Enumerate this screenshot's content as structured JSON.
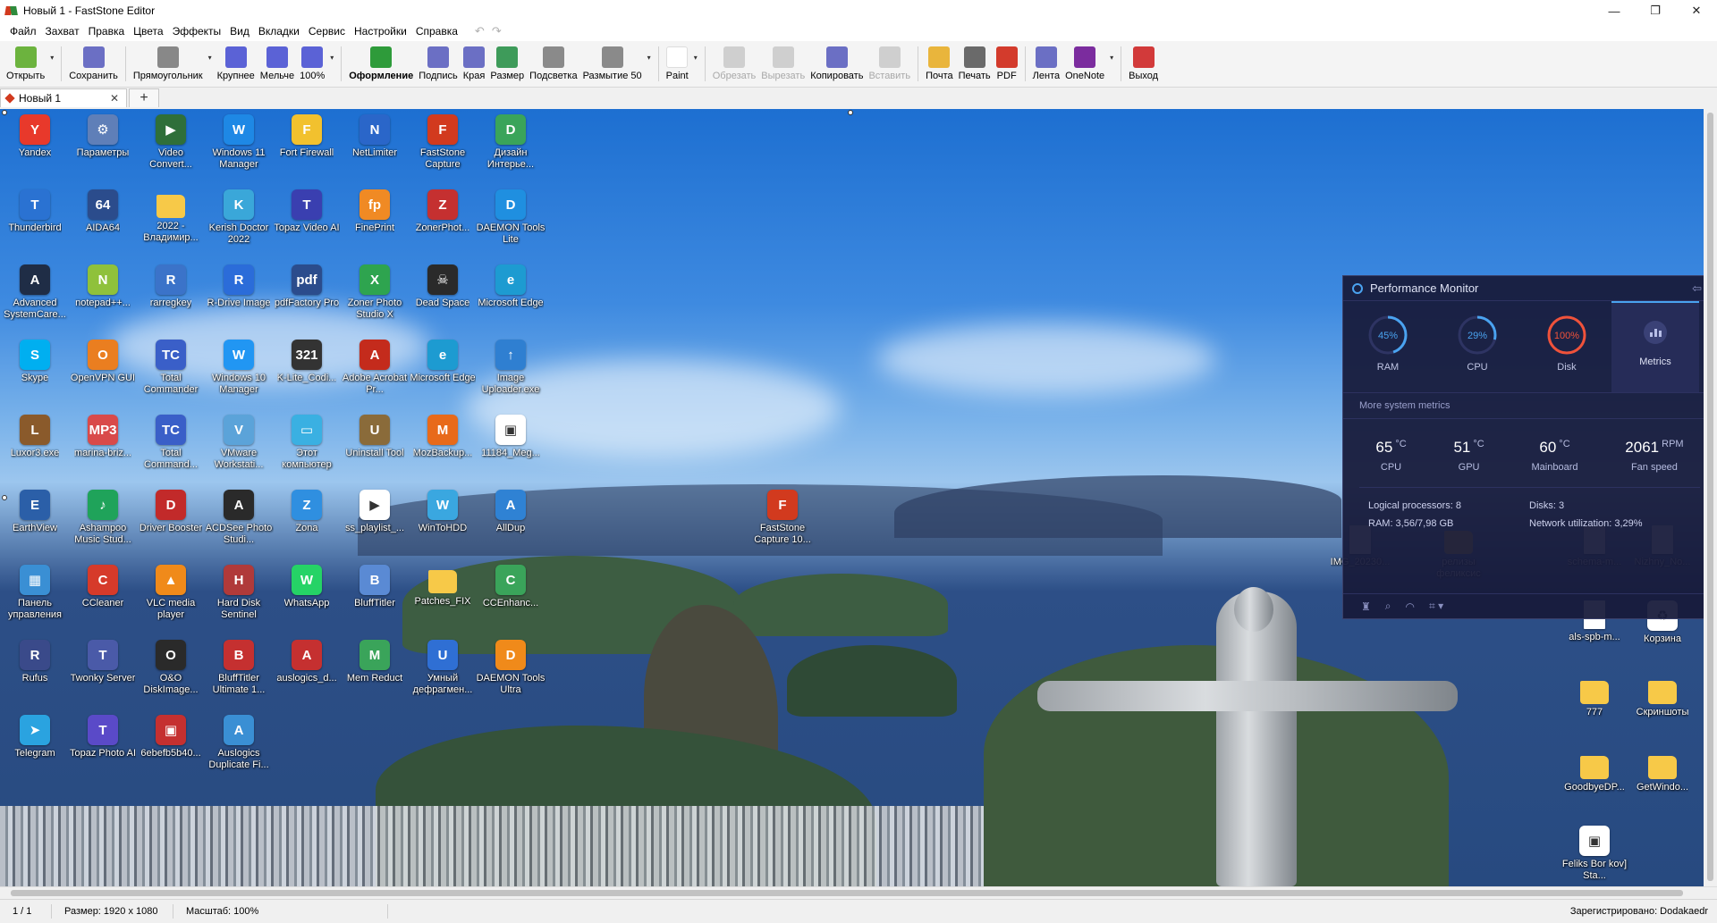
{
  "window": {
    "title": "Новый 1 - FastStone Editor",
    "controls": [
      "—",
      "❐",
      "✕"
    ]
  },
  "menu": [
    "Файл",
    "Захват",
    "Правка",
    "Цвета",
    "Эффекты",
    "Вид",
    "Вкладки",
    "Сервис",
    "Настройки",
    "Справка"
  ],
  "toolbar": [
    {
      "name": "open",
      "label": "Открыть",
      "color": "#6cb33e",
      "dropdown": true
    },
    {
      "name": "save",
      "label": "Сохранить",
      "color": "#6b6fc4"
    },
    {
      "name": "rectangle",
      "label": "Прямоугольник",
      "color": "#888888",
      "dropdown": true
    },
    {
      "name": "zoom-in",
      "label": "Крупнее",
      "color": "#5b62d6"
    },
    {
      "name": "zoom-out",
      "label": "Мельче",
      "color": "#5b62d6"
    },
    {
      "name": "zoom-100",
      "label": "100%",
      "color": "#5b62d6",
      "dropdown": true
    },
    {
      "name": "draw",
      "label": "Оформление",
      "color": "#2e9b3a",
      "bold": true
    },
    {
      "name": "caption",
      "label": "Подпись",
      "color": "#6b6fc4"
    },
    {
      "name": "edge",
      "label": "Края",
      "color": "#6b6fc4"
    },
    {
      "name": "resize",
      "label": "Размер",
      "color": "#3e9b5a"
    },
    {
      "name": "spotlight",
      "label": "Подсветка",
      "color": "#8a8a8a"
    },
    {
      "name": "blur",
      "label": "Размытие 50",
      "color": "#8a8a8a",
      "dropdown": true
    },
    {
      "name": "paint",
      "label": "Paint",
      "color": "#ffffff",
      "dropdown": true
    },
    {
      "name": "crop",
      "label": "Обрезать",
      "color": "#8a8a8a",
      "disabled": true
    },
    {
      "name": "cut",
      "label": "Вырезать",
      "color": "#8a8a8a",
      "disabled": true
    },
    {
      "name": "copy",
      "label": "Копировать",
      "color": "#6b6fc4"
    },
    {
      "name": "paste",
      "label": "Вставить",
      "color": "#8a8a8a",
      "disabled": true
    },
    {
      "name": "email",
      "label": "Почта",
      "color": "#e9b53c"
    },
    {
      "name": "print",
      "label": "Печать",
      "color": "#6a6a6a"
    },
    {
      "name": "pdf",
      "label": "PDF",
      "color": "#d33b2c"
    },
    {
      "name": "ribbon",
      "label": "Лента",
      "color": "#6b6fc4"
    },
    {
      "name": "onenote",
      "label": "OneNote",
      "color": "#7b2c9e",
      "dropdown": true
    },
    {
      "name": "exit",
      "label": "Выход",
      "color": "#d23a3a"
    }
  ],
  "tabs": {
    "current": "Новый 1",
    "close": "✕",
    "add": "+"
  },
  "desktop_icons": [
    {
      "label": "Yandex",
      "g": "Y",
      "c": "#e8392b"
    },
    {
      "label": "Параметры",
      "g": "⚙",
      "c": "#5f7fb8"
    },
    {
      "label": "Video Convert...",
      "g": "▶",
      "c": "#2f6f3a"
    },
    {
      "label": "Windows 11 Manager",
      "g": "W",
      "c": "#1e88e5"
    },
    {
      "label": "Fort Firewall",
      "g": "F",
      "c": "#f2c12e"
    },
    {
      "label": "NetLimiter",
      "g": "N",
      "c": "#2a66c9"
    },
    {
      "label": "FastStone Capture",
      "g": "F",
      "c": "#d23a1e"
    },
    {
      "label": "Дизайн Интерье...",
      "g": "D",
      "c": "#3aa45a"
    },
    {
      "label": "Thunderbird",
      "g": "T",
      "c": "#2a72d2"
    },
    {
      "label": "AIDA64",
      "g": "64",
      "c": "#2b4c8c"
    },
    {
      "label": "2022 - Владимир...",
      "g": "",
      "c": "folder"
    },
    {
      "label": "Kerish Doctor 2022",
      "g": "K",
      "c": "#3aa7d9"
    },
    {
      "label": "Topaz Video AI",
      "g": "T",
      "c": "#3a3fb0"
    },
    {
      "label": "FinePrint",
      "g": "fp",
      "c": "#f08a24"
    },
    {
      "label": "ZonerPhot...",
      "g": "Z",
      "c": "#c53030"
    },
    {
      "label": "DAEMON Tools Lite",
      "g": "D",
      "c": "#1f8fe0"
    },
    {
      "label": "Advanced SystemCare...",
      "g": "A",
      "c": "#1f2d46"
    },
    {
      "label": "notepad++...",
      "g": "N",
      "c": "#8fc13b"
    },
    {
      "label": "rarregkey",
      "g": "R",
      "c": "#3b73c9"
    },
    {
      "label": "R-Drive Image",
      "g": "R",
      "c": "#2b6cd9"
    },
    {
      "label": "pdfFactory Pro",
      "g": "pdf",
      "c": "#2b4c8c"
    },
    {
      "label": "Zoner Photo Studio X",
      "g": "X",
      "c": "#2ea44f"
    },
    {
      "label": "Dead Space",
      "g": "☠",
      "c": "#2a2a2a"
    },
    {
      "label": "Microsoft Edge",
      "g": "e",
      "c": "#1d9bd1"
    },
    {
      "label": "Skype",
      "g": "S",
      "c": "#00aff0"
    },
    {
      "label": "OpenVPN GUI",
      "g": "O",
      "c": "#ea7e20"
    },
    {
      "label": "Total Commander",
      "g": "TC",
      "c": "#3a5fc8"
    },
    {
      "label": "Windows 10 Manager",
      "g": "W",
      "c": "#2196f3"
    },
    {
      "label": "K-Lite_Codi...",
      "g": "321",
      "c": "#333333"
    },
    {
      "label": "Adobe Acrobat Pr...",
      "g": "A",
      "c": "#c42b1c"
    },
    {
      "label": "Microsoft Edge",
      "g": "e",
      "c": "#1d9bd1"
    },
    {
      "label": "Image Uploader.exe",
      "g": "↑",
      "c": "#2f7fd1"
    },
    {
      "label": "Luxor3.exe",
      "g": "L",
      "c": "#8a5a2b"
    },
    {
      "label": "marina-briz...",
      "g": "MP3",
      "c": "#d94a4a"
    },
    {
      "label": "Total Command...",
      "g": "TC",
      "c": "#3a5fc8"
    },
    {
      "label": "VMware Workstati...",
      "g": "V",
      "c": "#5ba3d9"
    },
    {
      "label": "Этот компьютер",
      "g": "▭",
      "c": "#3ab0e2"
    },
    {
      "label": "Uninstall Tool",
      "g": "U",
      "c": "#8a6b3a"
    },
    {
      "label": "MozBackup...",
      "g": "M",
      "c": "#e86a1a"
    },
    {
      "label": "11184_Meg...",
      "g": "▣",
      "c": "#ffffff"
    },
    {
      "label": "EarthView",
      "g": "E",
      "c": "#2b5fa8"
    },
    {
      "label": "Ashampoo Music Stud...",
      "g": "♪",
      "c": "#1fa35a"
    },
    {
      "label": "Driver Booster",
      "g": "D",
      "c": "#c22a2a"
    },
    {
      "label": "ACDSee Photo Studi...",
      "g": "A",
      "c": "#2a2a2a"
    },
    {
      "label": "Zona",
      "g": "Z",
      "c": "#2f8fe0"
    },
    {
      "label": "ss_playlist_...",
      "g": "▶",
      "c": "#ffffff"
    },
    {
      "label": "WinToHDD",
      "g": "W",
      "c": "#3aa7e0"
    },
    {
      "label": "AllDup",
      "g": "A",
      "c": "#2f82d4"
    },
    {
      "label": "Панель управления",
      "g": "▦",
      "c": "#3a8fd4"
    },
    {
      "label": "CCleaner",
      "g": "C",
      "c": "#d63a2a"
    },
    {
      "label": "VLC media player",
      "g": "▲",
      "c": "#f08a1a"
    },
    {
      "label": "Hard Disk Sentinel",
      "g": "H",
      "c": "#b03a3a"
    },
    {
      "label": "WhatsApp",
      "g": "W",
      "c": "#25d366"
    },
    {
      "label": "BluffTitler",
      "g": "B",
      "c": "#5a8ad4"
    },
    {
      "label": "Patches_FIX",
      "g": "",
      "c": "folder"
    },
    {
      "label": "CCEnhanc...",
      "g": "C",
      "c": "#3aa45a"
    },
    {
      "label": "Rufus",
      "g": "R",
      "c": "#3a4a8a"
    },
    {
      "label": "Twonky Server",
      "g": "T",
      "c": "#4a5aa8"
    },
    {
      "label": "O&O DiskImage...",
      "g": "O",
      "c": "#2a2a2a"
    },
    {
      "label": "BluffTitler Ultimate 1...",
      "g": "B",
      "c": "#c53030"
    },
    {
      "label": "auslogics_d...",
      "g": "A",
      "c": "#c53030"
    },
    {
      "label": "Mem Reduct",
      "g": "M",
      "c": "#3aa45a"
    },
    {
      "label": "Умный дефрагмен...",
      "g": "U",
      "c": "#2f6fd4"
    },
    {
      "label": "DAEMON Tools Ultra",
      "g": "D",
      "c": "#f08a1a"
    },
    {
      "label": "Telegram",
      "g": "➤",
      "c": "#2aa3e0"
    },
    {
      "label": "Topaz Photo AI",
      "g": "T",
      "c": "#5a4ac8"
    },
    {
      "label": "6ebefb5b40...",
      "g": "▣",
      "c": "#c53030"
    },
    {
      "label": "Auslogics Duplicate Fi...",
      "g": "A",
      "c": "#3a8fd4"
    }
  ],
  "center_icon": {
    "label": "FastStone Capture 10...",
    "g": "F",
    "c": "#d23a1e"
  },
  "right_icons": [
    {
      "label": "IMG_20230...",
      "g": "",
      "c": "file"
    },
    {
      "label": "релизы феликсис",
      "g": "",
      "c": "folder"
    },
    {
      "label": "schema-m...",
      "g": "",
      "c": "file"
    },
    {
      "label": "Nizhny_No...",
      "g": "",
      "c": "file"
    },
    {
      "label": "als-spb-m...",
      "g": "",
      "c": "file"
    },
    {
      "label": "Корзина",
      "g": "♻",
      "c": "#ffffff"
    },
    {
      "label": "777",
      "g": "",
      "c": "folder"
    },
    {
      "label": "Скриншоты",
      "g": "",
      "c": "folder"
    },
    {
      "label": "GoodbyeDP...",
      "g": "",
      "c": "folder"
    },
    {
      "label": "GetWindo...",
      "g": "",
      "c": "folder"
    },
    {
      "label": "Feliks Bor kov] Sta...",
      "g": "▣",
      "c": "#ffffff"
    }
  ],
  "perf": {
    "title": "Performance Monitor",
    "back": "⇦",
    "gauges": [
      {
        "label": "RAM",
        "value": "45%",
        "fraction": 0.45,
        "color": "#4aa3f0"
      },
      {
        "label": "CPU",
        "value": "29%",
        "fraction": 0.29,
        "color": "#4aa3f0"
      },
      {
        "label": "Disk",
        "value": "100%",
        "fraction": 1.0,
        "color": "#f0523a"
      }
    ],
    "metrics_label": "Metrics",
    "more": "More system metrics",
    "temps": [
      {
        "value": "65",
        "unit": "°C",
        "name": "CPU"
      },
      {
        "value": "51",
        "unit": "°C",
        "name": "GPU"
      },
      {
        "value": "60",
        "unit": "°C",
        "name": "Mainboard"
      },
      {
        "value": "2061",
        "unit": "RPM",
        "name": "Fan speed"
      }
    ],
    "info": {
      "logical": "Logical processors:  8",
      "disks": "Disks:  3",
      "ram": "RAM:  3,56/7,98 GB",
      "network": "Network utilization:  3,29%"
    }
  },
  "status": {
    "page": "1 / 1",
    "size": "Размер: 1920 x 1080",
    "zoom": "Масштаб: 100%",
    "registered": "Зарегистрировано: Dodakaedr"
  }
}
